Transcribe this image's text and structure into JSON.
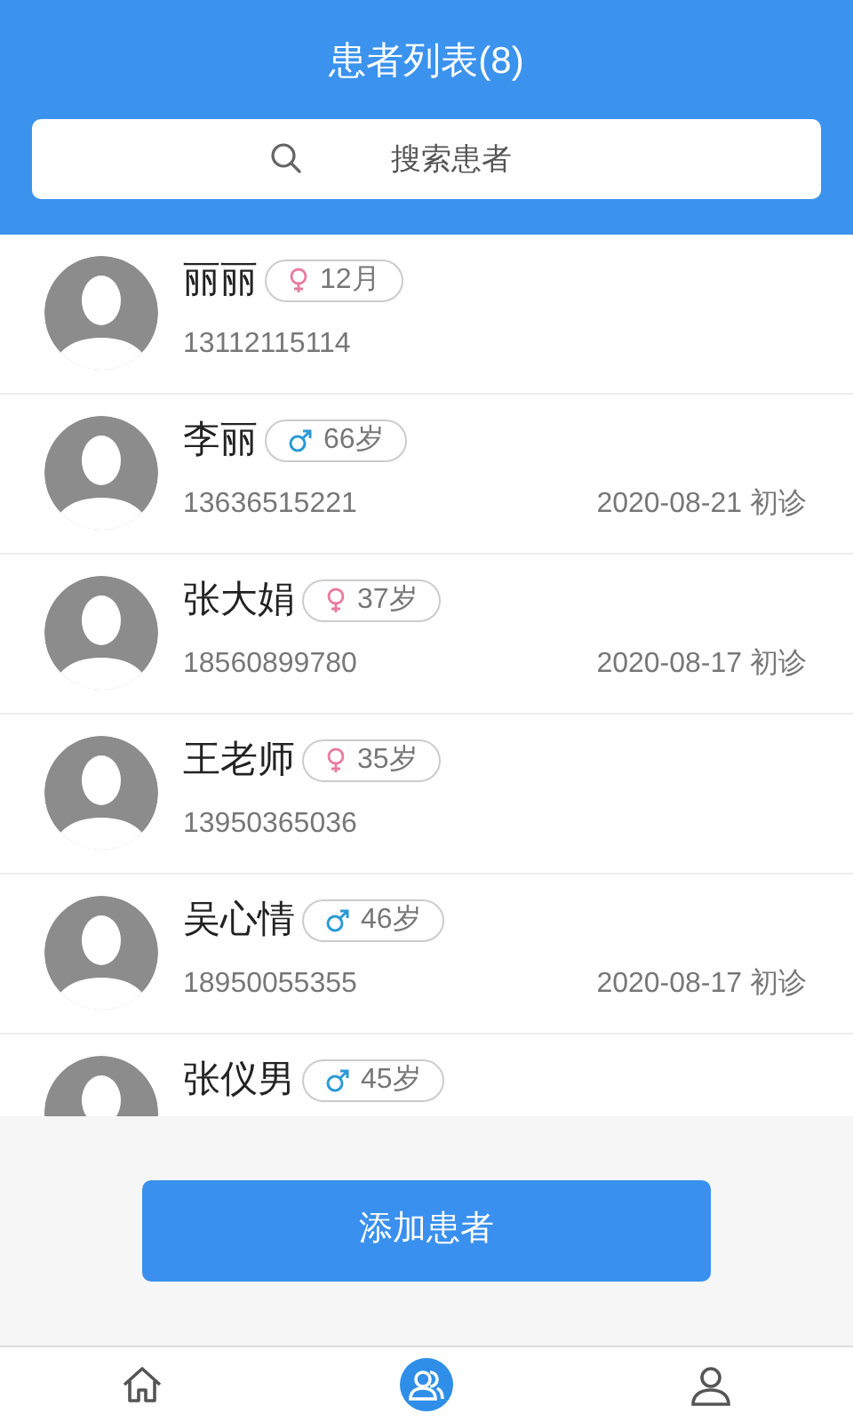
{
  "header": {
    "title": "患者列表(8)",
    "search": {
      "placeholder": "搜索患者"
    }
  },
  "patients": [
    {
      "name": "丽丽",
      "kind": "female",
      "age": "12月",
      "phone": "13112115114"
    },
    {
      "name": "李丽",
      "kind": "male",
      "age": "66岁",
      "phone": "13636515221",
      "visit": "2020-08-21 初诊"
    },
    {
      "name": "张大娟",
      "kind": "female",
      "age": "37岁",
      "phone": "18560899780",
      "visit": "2020-08-17 初诊"
    },
    {
      "name": "王老师",
      "kind": "female",
      "age": "35岁",
      "phone": "13950365036"
    },
    {
      "name": "吴心情",
      "kind": "male",
      "age": "46岁",
      "phone": "18950055355",
      "visit": "2020-08-17 初诊"
    },
    {
      "name": "张仪男",
      "kind": "male",
      "age": "45岁"
    }
  ],
  "add_button": "添加患者",
  "tab_bar": [
    {
      "kind": "home",
      "selected": false
    },
    {
      "kind": "patients",
      "selected": true
    },
    {
      "kind": "profile",
      "selected": false
    }
  ]
}
